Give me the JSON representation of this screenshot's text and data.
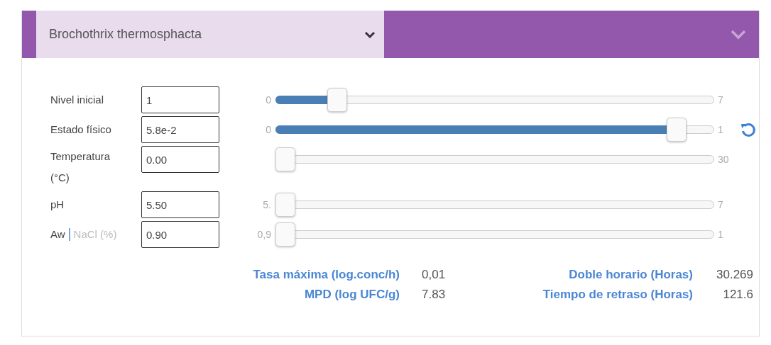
{
  "header": {
    "organism": "Brochothrix thermosphacta"
  },
  "parameters": [
    {
      "label": "Nivel inicial",
      "value": "1",
      "min": "0",
      "max": "7",
      "level": 0.14
    },
    {
      "label": "Estado físico",
      "value": "5.8e-2",
      "min": "0",
      "max": "1",
      "level": 0.915,
      "reset": true
    },
    {
      "label": "Temperatura (°C)",
      "value": "0.00",
      "max": "30",
      "level": 0
    },
    {
      "label": "pH",
      "value": "5.50",
      "min": "5.",
      "max": "7",
      "level": 0
    },
    {
      "label": "Aw",
      "alt_label": "NaCl (%)",
      "value": "0.90",
      "min": "0,9",
      "max": "1",
      "level": 0
    }
  ],
  "results": [
    {
      "label": "Tasa máxima (log.conc/h)",
      "value": "0,01"
    },
    {
      "label": "Doble horario (Horas)",
      "value": "30.269"
    },
    {
      "label": "MPD (log UFC/g)",
      "value": "7.83"
    },
    {
      "label": "Tiempo de retraso (Horas)",
      "value": "121.6"
    }
  ]
}
